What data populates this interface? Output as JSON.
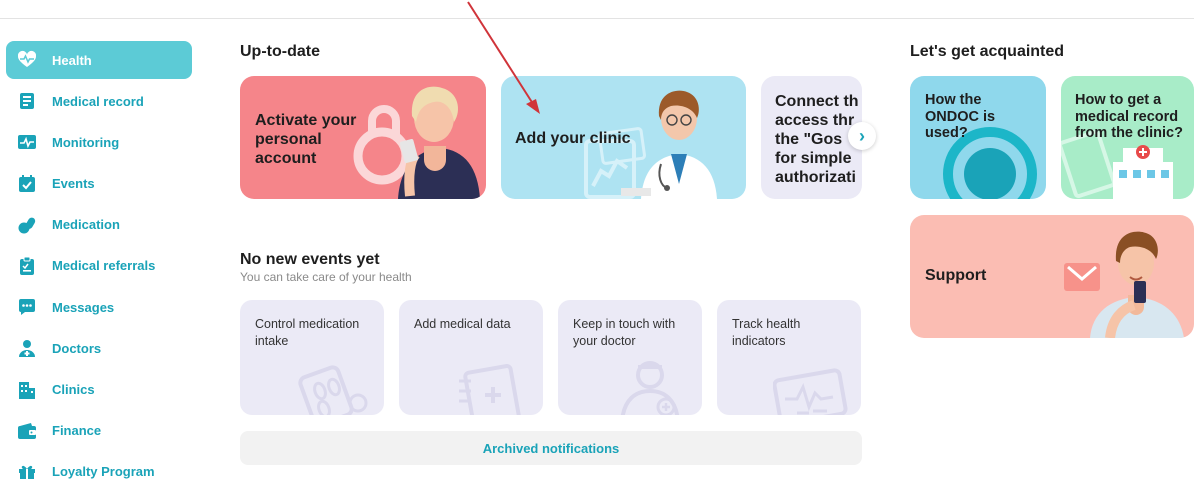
{
  "sidebar": {
    "items": [
      {
        "label": "Health",
        "icon": "heart-pulse-icon",
        "active": true
      },
      {
        "label": "Medical record",
        "icon": "medical-record-icon"
      },
      {
        "label": "Monitoring",
        "icon": "monitoring-icon"
      },
      {
        "label": "Events",
        "icon": "calendar-check-icon"
      },
      {
        "label": "Medication",
        "icon": "pills-icon"
      },
      {
        "label": "Medical referrals",
        "icon": "clipboard-icon"
      },
      {
        "label": "Messages",
        "icon": "chat-icon"
      },
      {
        "label": "Doctors",
        "icon": "doctor-icon"
      },
      {
        "label": "Clinics",
        "icon": "building-icon"
      },
      {
        "label": "Finance",
        "icon": "wallet-icon"
      },
      {
        "label": "Loyalty Program",
        "icon": "gift-icon"
      }
    ]
  },
  "uptodate": {
    "title": "Up-to-date",
    "cards": [
      {
        "text": "Activate your personal account",
        "color": "#f5858a"
      },
      {
        "text": "Add your clinic",
        "color": "#aee3f2"
      },
      {
        "text": "Connect through access through the \"Gosuslugi\" for simple authorization",
        "lines": [
          "Connect th",
          "access thr",
          "the \"Gos",
          "for simple",
          "authorizati"
        ],
        "color": "#ebeaf6"
      }
    ]
  },
  "events": {
    "title": "No new events yet",
    "subtitle": "You can take care of your health",
    "cards": [
      {
        "text": "Control medication intake"
      },
      {
        "text": "Add medical data"
      },
      {
        "text": "Keep in touch with your doctor"
      },
      {
        "text": "Track health indicators"
      }
    ],
    "archived_label": "Archived notifications"
  },
  "acquainted": {
    "title": "Let's get acquainted",
    "cards": [
      {
        "text": "How the ONDOC is used?",
        "color": "#8fd8ec"
      },
      {
        "text": "How to get a medical record from the clinic?",
        "color": "#a8ecc8"
      }
    ],
    "support": {
      "text": "Support",
      "color": "#fbbdb3"
    }
  },
  "colors": {
    "accent": "#5ccbd6",
    "accent_text": "#1aa3b8",
    "annotation_arrow": "#d0343a"
  }
}
